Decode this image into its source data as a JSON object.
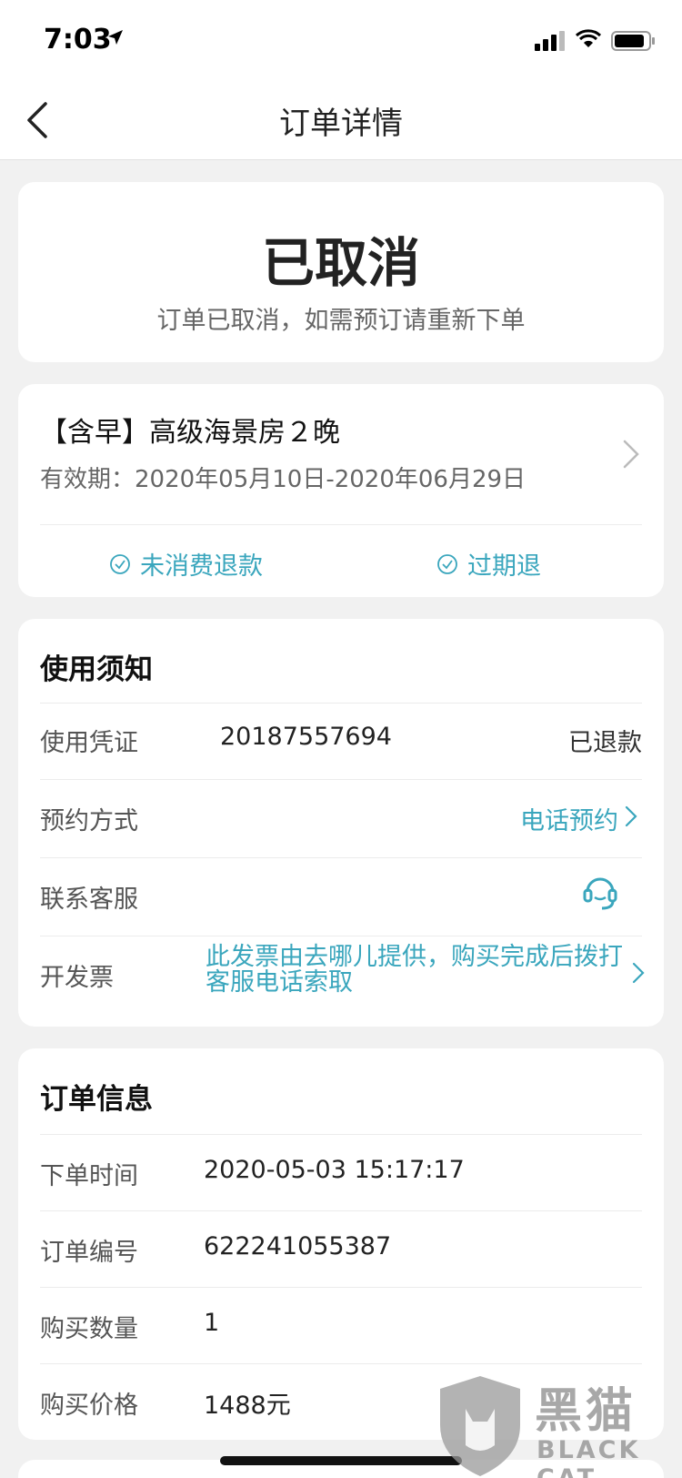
{
  "status_bar": {
    "time": "7:03"
  },
  "nav": {
    "title": "订单详情"
  },
  "order_status": {
    "title": "已取消",
    "subtitle": "订单已取消，如需预订请重新下单"
  },
  "product": {
    "title": "【含早】高级海景房２晚",
    "validity": "有效期：2020年05月10日-2020年06月29日",
    "policies": [
      "未消费退款",
      "过期退"
    ]
  },
  "usage": {
    "section_title": "使用须知",
    "voucher_label": "使用凭证",
    "voucher_number": "20187557694",
    "voucher_status": "已退款",
    "booking_label": "预约方式",
    "booking_value": "电话预约",
    "service_label": "联系客服",
    "invoice_label": "开发票",
    "invoice_text": "此发票由去哪儿提供，购买完成后拨打客服电话索取"
  },
  "order_info": {
    "section_title": "订单信息",
    "rows": [
      {
        "label": "下单时间",
        "value": "2020-05-03 15:17:17"
      },
      {
        "label": "订单编号",
        "value": "622241055387"
      },
      {
        "label": "购买数量",
        "value": "1"
      },
      {
        "label": "购买价格",
        "value": "1488元"
      }
    ]
  },
  "watermark": {
    "text": "黑猫",
    "sub": "BLACK CAT"
  },
  "colors": {
    "accent": "#3aa6bd",
    "background": "#f1f1f1",
    "card": "#ffffff"
  }
}
